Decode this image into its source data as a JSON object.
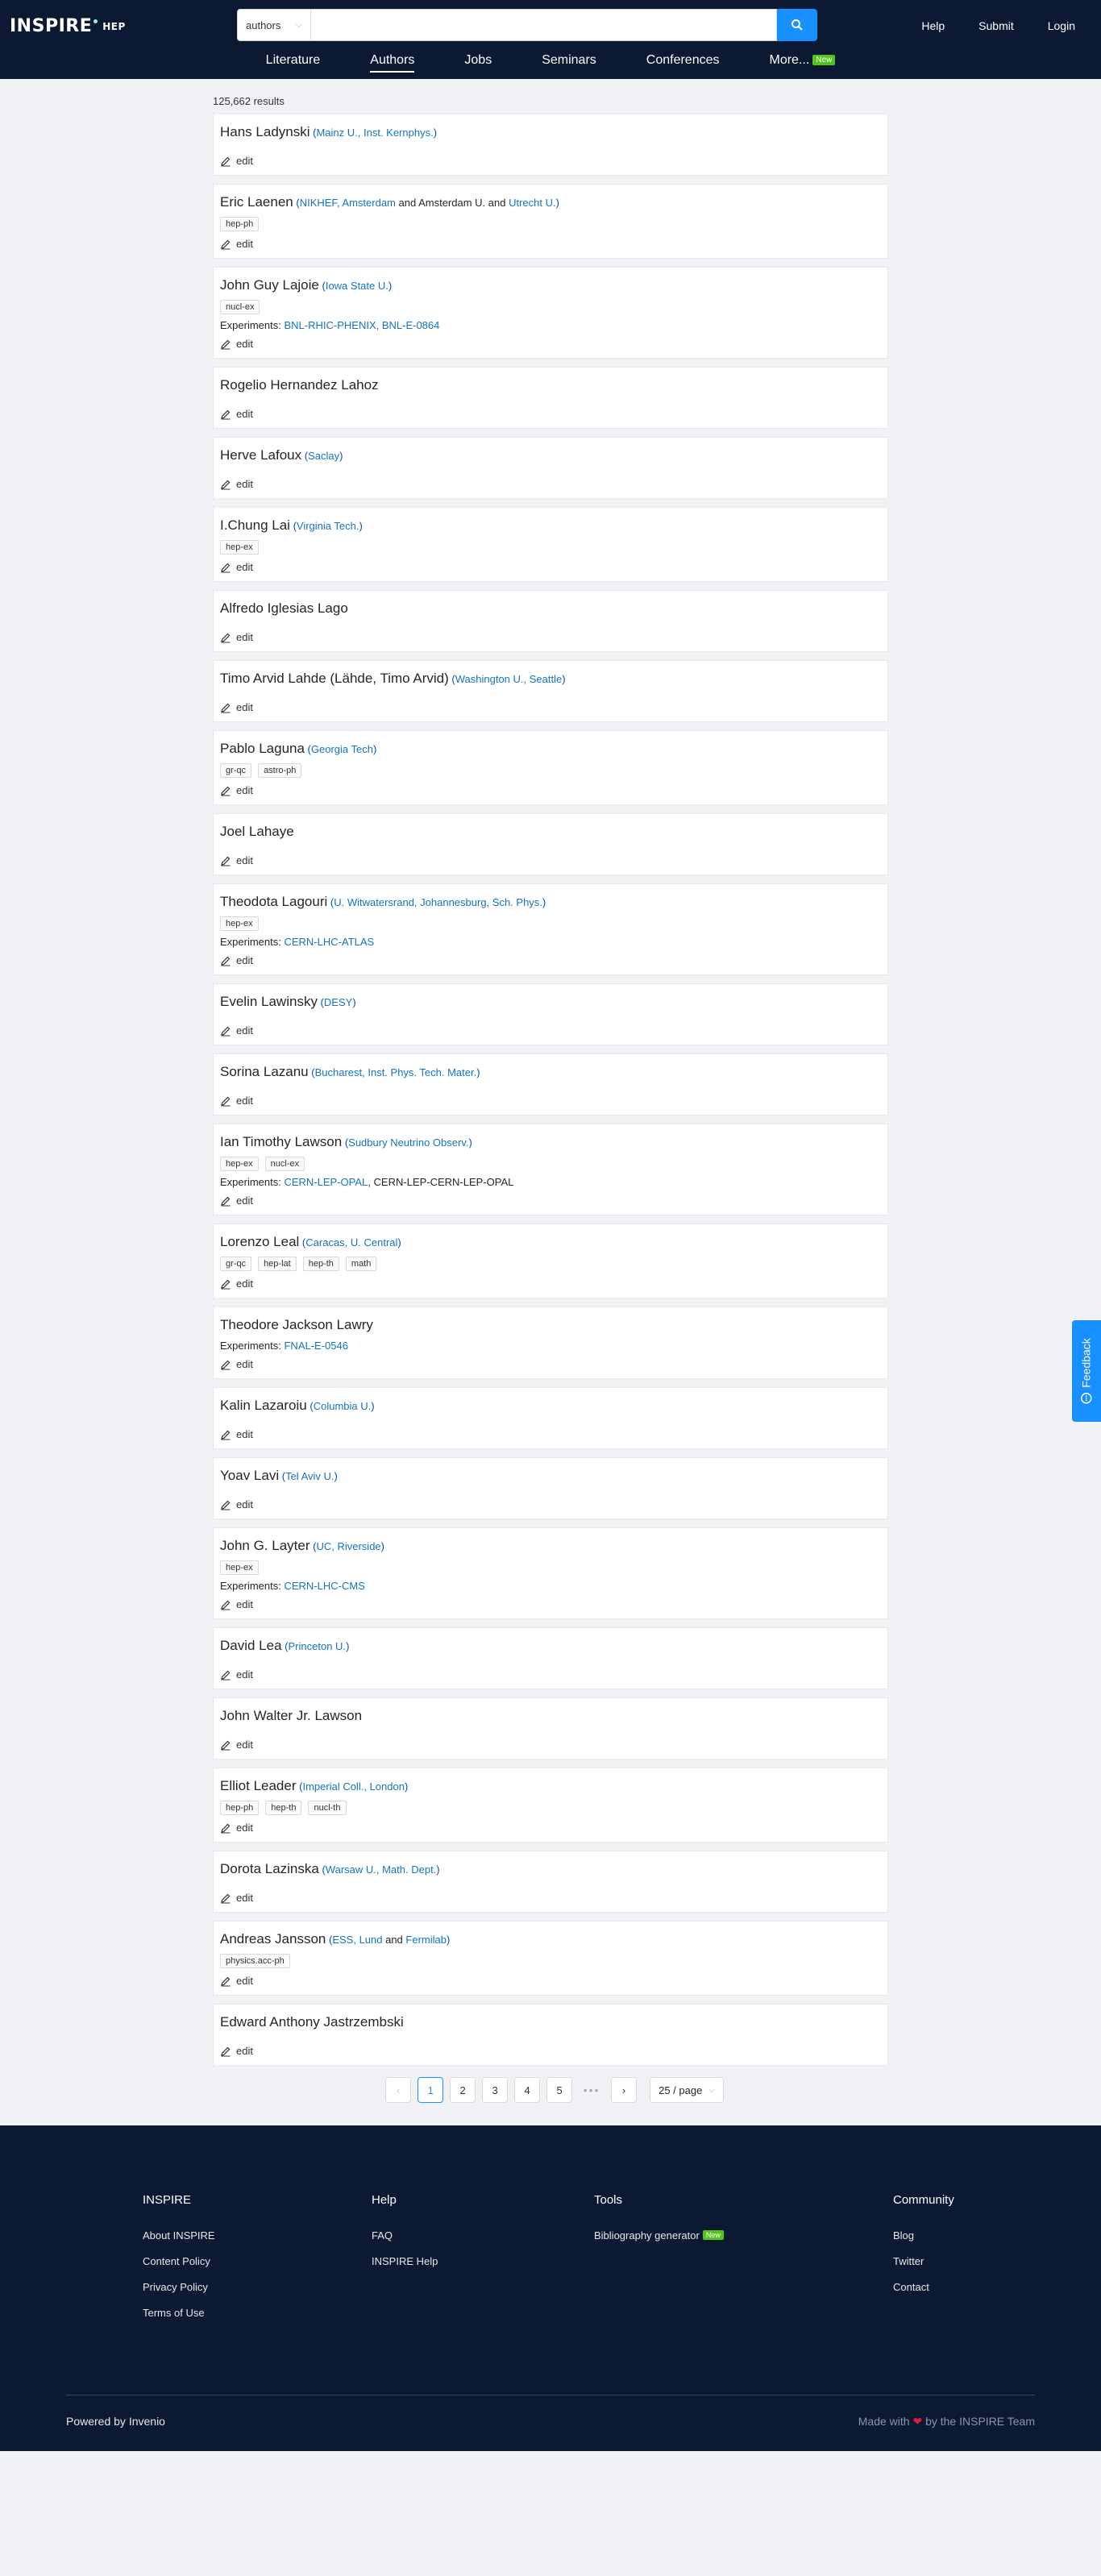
{
  "header": {
    "logo_text": "INSPIRE",
    "logo_sub": "HEP",
    "search_scope": "authors",
    "search_placeholder": "",
    "top_links": [
      "Help",
      "Submit",
      "Login"
    ],
    "nav": [
      {
        "label": "Literature",
        "active": false
      },
      {
        "label": "Authors",
        "active": true
      },
      {
        "label": "Jobs",
        "active": false
      },
      {
        "label": "Seminars",
        "active": false
      },
      {
        "label": "Conferences",
        "active": false
      },
      {
        "label": "More...",
        "active": false,
        "badge": "New"
      }
    ]
  },
  "results_count": "125,662 results",
  "edit_label": "edit",
  "experiments_prefix": "Experiments: ",
  "authors": [
    {
      "name": "Hans Ladynski",
      "aff": [
        {
          "t": "Mainz U., Inst. Kernphys.",
          "link": true
        }
      ],
      "tags": [],
      "experiments": []
    },
    {
      "name": "Eric Laenen",
      "aff": [
        {
          "t": "NIKHEF, Amsterdam",
          "link": true
        },
        {
          "t": " and Amsterdam U. and ",
          "link": false
        },
        {
          "t": "Utrecht U.",
          "link": true
        }
      ],
      "tags": [
        "hep-ph"
      ],
      "experiments": []
    },
    {
      "name": "John Guy Lajoie",
      "aff": [
        {
          "t": "Iowa State U.",
          "link": true
        }
      ],
      "tags": [
        "nucl-ex"
      ],
      "experiments": [
        {
          "t": "BNL-RHIC-PHENIX, BNL-E-0864",
          "link": true
        }
      ]
    },
    {
      "name": "Rogelio Hernandez Lahoz",
      "aff": [],
      "tags": [],
      "experiments": []
    },
    {
      "name": "Herve Lafoux",
      "aff": [
        {
          "t": "Saclay",
          "link": true
        }
      ],
      "tags": [],
      "experiments": []
    },
    {
      "name": "I.Chung Lai",
      "aff": [
        {
          "t": "Virginia Tech.",
          "link": true
        }
      ],
      "tags": [
        "hep-ex"
      ],
      "experiments": []
    },
    {
      "name": "Alfredo Iglesias Lago",
      "aff": [],
      "tags": [],
      "experiments": []
    },
    {
      "name": "Timo Arvid Lahde (Lähde, Timo Arvid)",
      "aff": [
        {
          "t": "Washington U., Seattle",
          "link": true
        }
      ],
      "tags": [],
      "experiments": []
    },
    {
      "name": "Pablo Laguna",
      "aff": [
        {
          "t": "Georgia Tech",
          "link": true
        }
      ],
      "tags": [
        "gr-qc",
        "astro-ph"
      ],
      "experiments": []
    },
    {
      "name": "Joel Lahaye",
      "aff": [],
      "tags": [],
      "experiments": []
    },
    {
      "name": "Theodota Lagouri",
      "aff": [
        {
          "t": "U. Witwatersrand, Johannesburg, Sch. Phys.",
          "link": true
        }
      ],
      "tags": [
        "hep-ex"
      ],
      "experiments": [
        {
          "t": "CERN-LHC-ATLAS",
          "link": true
        }
      ]
    },
    {
      "name": "Evelin Lawinsky",
      "aff": [
        {
          "t": "DESY",
          "link": true
        }
      ],
      "tags": [],
      "experiments": []
    },
    {
      "name": "Sorina Lazanu",
      "aff": [
        {
          "t": "Bucharest, Inst. Phys. Tech. Mater.",
          "link": true
        }
      ],
      "tags": [],
      "experiments": []
    },
    {
      "name": "Ian Timothy Lawson",
      "aff": [
        {
          "t": "Sudbury Neutrino Observ.",
          "link": true
        }
      ],
      "tags": [
        "hep-ex",
        "nucl-ex"
      ],
      "experiments": [
        {
          "t": "CERN-LEP-OPAL",
          "link": true
        },
        {
          "t": ", CERN-LEP-CERN-LEP-OPAL",
          "link": false
        }
      ]
    },
    {
      "name": "Lorenzo Leal",
      "aff": [
        {
          "t": "Caracas, U. Central",
          "link": true
        }
      ],
      "tags": [
        "gr-qc",
        "hep-lat",
        "hep-th",
        "math"
      ],
      "experiments": []
    },
    {
      "name": "Theodore Jackson Lawry",
      "aff": [],
      "tags": [],
      "experiments": [
        {
          "t": "FNAL-E-0546",
          "link": true
        }
      ]
    },
    {
      "name": "Kalin Lazaroiu",
      "aff": [
        {
          "t": "Columbia U.",
          "link": true
        }
      ],
      "tags": [],
      "experiments": []
    },
    {
      "name": "Yoav Lavi",
      "aff": [
        {
          "t": "Tel Aviv U.",
          "link": true
        }
      ],
      "tags": [],
      "experiments": []
    },
    {
      "name": "John G. Layter",
      "aff": [
        {
          "t": "UC, Riverside",
          "link": true
        }
      ],
      "tags": [
        "hep-ex"
      ],
      "experiments": [
        {
          "t": "CERN-LHC-CMS",
          "link": true
        }
      ]
    },
    {
      "name": "David Lea",
      "aff": [
        {
          "t": "Princeton U.",
          "link": true
        }
      ],
      "tags": [],
      "experiments": []
    },
    {
      "name": "John Walter Jr. Lawson",
      "aff": [],
      "tags": [],
      "experiments": []
    },
    {
      "name": "Elliot Leader",
      "aff": [
        {
          "t": "Imperial Coll., London",
          "link": true
        }
      ],
      "tags": [
        "hep-ph",
        "hep-th",
        "nucl-th"
      ],
      "experiments": []
    },
    {
      "name": "Dorota Lazinska",
      "aff": [
        {
          "t": "Warsaw U., Math. Dept.",
          "link": true
        }
      ],
      "tags": [],
      "experiments": []
    },
    {
      "name": "Andreas Jansson",
      "aff": [
        {
          "t": "ESS, Lund",
          "link": true
        },
        {
          "t": " and ",
          "link": false
        },
        {
          "t": "Fermilab",
          "link": true
        }
      ],
      "tags": [
        "physics.acc-ph"
      ],
      "experiments": []
    },
    {
      "name": "Edward Anthony Jastrzembski",
      "aff": [],
      "tags": [],
      "experiments": []
    }
  ],
  "pagination": {
    "prev": "‹",
    "pages": [
      "1",
      "2",
      "3",
      "4",
      "5"
    ],
    "active_page": "1",
    "ellipsis": "•••",
    "next": "›",
    "page_size": "25 / page"
  },
  "feedback_label": "Feedback",
  "footer": {
    "columns": [
      {
        "title": "INSPIRE",
        "links": [
          {
            "t": "About INSPIRE"
          },
          {
            "t": "Content Policy"
          },
          {
            "t": "Privacy Policy"
          },
          {
            "t": "Terms of Use"
          }
        ]
      },
      {
        "title": "Help",
        "links": [
          {
            "t": "FAQ"
          },
          {
            "t": "INSPIRE Help"
          }
        ]
      },
      {
        "title": "Tools",
        "links": [
          {
            "t": "Bibliography generator",
            "badge": "New"
          }
        ]
      },
      {
        "title": "Community",
        "links": [
          {
            "t": "Blog"
          },
          {
            "t": "Twitter"
          },
          {
            "t": "Contact"
          }
        ]
      }
    ],
    "powered_by": "Powered by Invenio",
    "made_with_prefix": "Made with",
    "made_with_suffix": "by the INSPIRE Team"
  },
  "colors": {
    "header_bg": "#0b1932",
    "accent": "#1890ff",
    "badge_green": "#52c41a",
    "heart": "#e0193d"
  }
}
